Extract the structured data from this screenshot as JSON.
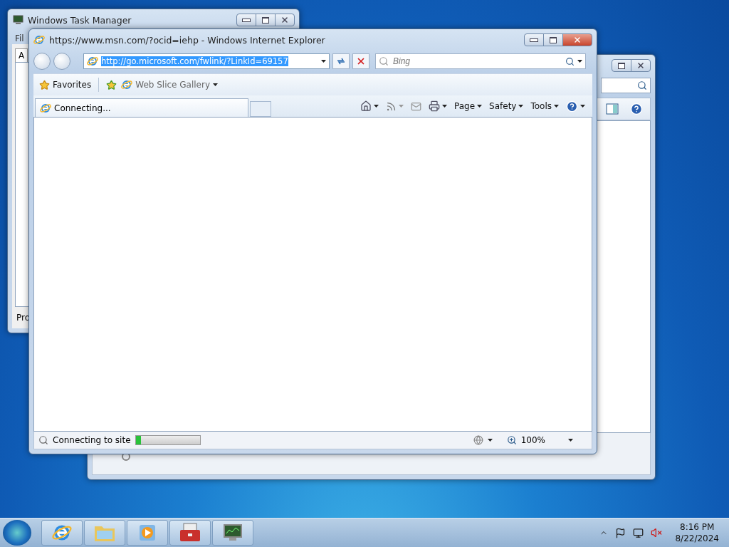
{
  "task_manager": {
    "title": "Windows Task Manager",
    "menu_item": "Fil",
    "tab": "A",
    "status": "Pro"
  },
  "ie": {
    "title": "https://www.msn.com/?ocid=iehp - Windows Internet Explorer",
    "address": {
      "value": "http://go.microsoft.com/fwlink/?LinkId=69157",
      "selected": true
    },
    "search": {
      "placeholder": "Bing"
    },
    "favorites": [
      {
        "label": "Favorites",
        "kind": "favorites"
      },
      {
        "label": "Web Slice Gallery",
        "kind": "slice"
      }
    ],
    "tabs": [
      {
        "label": "Connecting...",
        "selected": true
      }
    ],
    "commands": [
      {
        "label": "Page"
      },
      {
        "label": "Safety"
      },
      {
        "label": "Tools"
      }
    ],
    "status": {
      "text": "Connecting to site",
      "progress": {
        "level": 0.08
      },
      "zoom": "100%"
    }
  },
  "taskbar": {
    "items": [
      {
        "kind": "ie",
        "selected": false
      },
      {
        "kind": "folder",
        "selected": false
      },
      {
        "kind": "media",
        "selected": false
      },
      {
        "kind": "toolbox",
        "selected": false
      },
      {
        "kind": "monitor",
        "selected": false
      }
    ],
    "clock": {
      "time": "8:16 PM",
      "date": "8/22/2024"
    }
  }
}
